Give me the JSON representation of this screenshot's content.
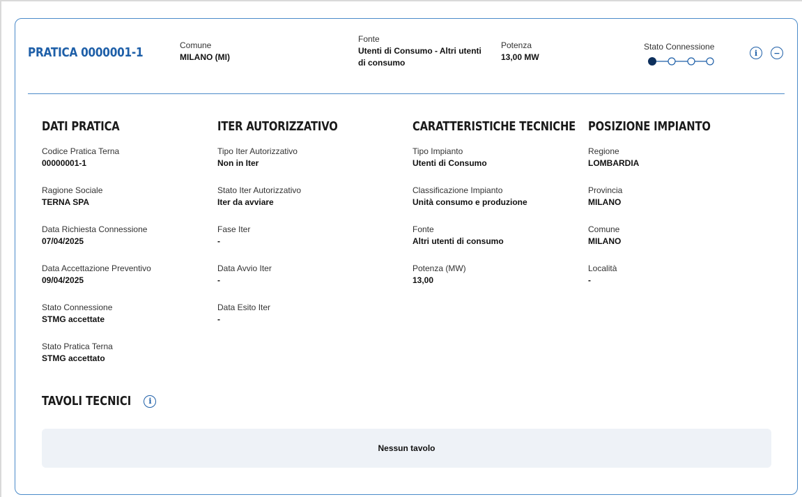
{
  "header": {
    "title": "PRATICA 0000001-1",
    "comune_label": "Comune",
    "comune_value": "MILANO (MI)",
    "fonte_label": "Fonte",
    "fonte_value_line1": "Utenti di Consumo - Altri utenti",
    "fonte_value_line2": "di consumo",
    "potenza_label": "Potenza",
    "potenza_value": "13,00 MW",
    "stato_label": "Stato Connessione",
    "stato_step": 1,
    "stato_steps_total": 4,
    "info_icon": "info-icon",
    "collapse_icon": "minus-circle-icon",
    "accent": "#1e5fa8"
  },
  "dati_pratica": {
    "heading": "DATI PRATICA",
    "items": [
      {
        "label": "Codice Pratica Terna",
        "value": "00000001-1"
      },
      {
        "label": "Ragione Sociale",
        "value": "TERNA SPA"
      },
      {
        "label": "Data Richiesta Connessione",
        "value": "07/04/2025"
      },
      {
        "label": "Data Accettazione Preventivo",
        "value": "09/04/2025"
      },
      {
        "label": "Stato Connessione",
        "value": "STMG accettate"
      },
      {
        "label": "Stato Pratica Terna",
        "value": "STMG accettato"
      }
    ]
  },
  "iter": {
    "heading": "ITER AUTORIZZATIVO",
    "items": [
      {
        "label": "Tipo Iter Autorizzativo",
        "value": "Non in Iter"
      },
      {
        "label": "Stato Iter Autorizzativo",
        "value": "Iter da avviare"
      },
      {
        "label": "Fase Iter",
        "value": "-"
      },
      {
        "label": "Data Avvio Iter",
        "value": "-"
      },
      {
        "label": "Data Esito Iter",
        "value": "-"
      }
    ]
  },
  "caratteristiche": {
    "heading": "CARATTERISTICHE TECNICHE",
    "items": [
      {
        "label": "Tipo Impianto",
        "value": "Utenti di Consumo"
      },
      {
        "label": "Classificazione Impianto",
        "value": "Unità consumo e produzione"
      },
      {
        "label": "Fonte",
        "value": "Altri utenti di consumo"
      },
      {
        "label": "Potenza (MW)",
        "value": "13,00"
      }
    ]
  },
  "posizione": {
    "heading": "POSIZIONE IMPIANTO",
    "items": [
      {
        "label": "Regione",
        "value": "LOMBARDIA"
      },
      {
        "label": "Provincia",
        "value": "MILANO"
      },
      {
        "label": "Comune",
        "value": "MILANO"
      },
      {
        "label": "Località",
        "value": "-"
      }
    ]
  },
  "tavoli": {
    "heading": "TAVOLI TECNICI",
    "empty_text": "Nessun tavolo"
  }
}
